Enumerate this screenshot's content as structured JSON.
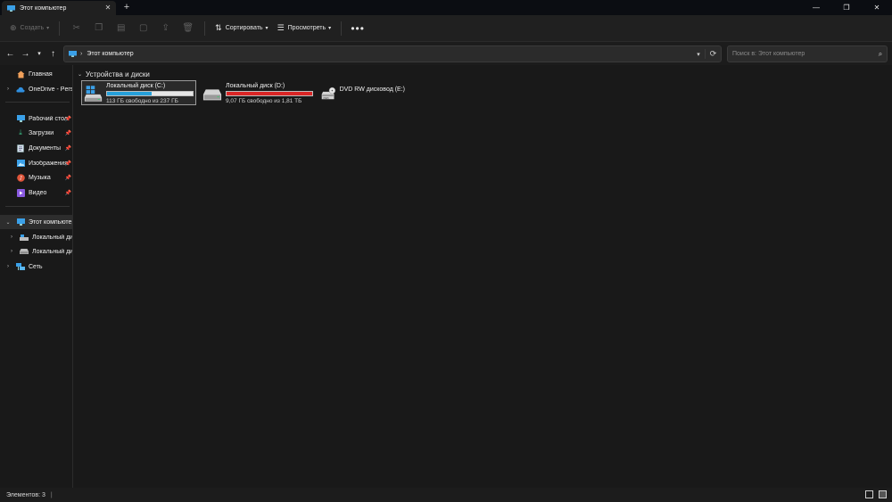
{
  "window": {
    "tab_title": "Этот компьютер",
    "tab_close": "✕",
    "new_tab": "+",
    "minimize": "—",
    "maximize": "❐",
    "close": "✕"
  },
  "toolbar": {
    "new_label": "Создать",
    "sort_label": "Сортировать",
    "view_label": "Просмотреть",
    "more": "•••"
  },
  "address": {
    "crumb": "Этот компьютер",
    "search_placeholder": "Поиск в: Этот компьютер"
  },
  "sidebar": {
    "items": [
      {
        "label": "Главная",
        "icon": "home-icon"
      },
      {
        "label": "OneDrive - Personal",
        "icon": "cloud-icon"
      },
      {
        "label": "Рабочий стол",
        "icon": "desktop-icon",
        "pinned": true
      },
      {
        "label": "Загрузки",
        "icon": "download-icon",
        "pinned": true
      },
      {
        "label": "Документы",
        "icon": "document-icon",
        "pinned": true
      },
      {
        "label": "Изображения",
        "icon": "image-icon",
        "pinned": true
      },
      {
        "label": "Музыка",
        "icon": "music-icon",
        "pinned": true
      },
      {
        "label": "Видео",
        "icon": "video-icon",
        "pinned": true
      },
      {
        "label": "Этот компьютер",
        "icon": "pc-icon",
        "selected": true
      },
      {
        "label": "Локальный диск (C:)",
        "icon": "drive-icon"
      },
      {
        "label": "Локальный диск (D:)",
        "icon": "drive-icon"
      },
      {
        "label": "Сеть",
        "icon": "network-icon"
      }
    ]
  },
  "content": {
    "group_title": "Устройства и диски",
    "drives": [
      {
        "name": "Локальный диск (C:)",
        "free": "113 ГБ свободно из 237 ГБ",
        "used_fraction": 0.52,
        "bar_color": "#26a0da",
        "icon": "windows-drive-icon"
      },
      {
        "name": "Локальный диск (D:)",
        "free": "9,07 ГБ свободно из 1,81 ТБ",
        "used_fraction": 0.995,
        "bar_color": "#da2626",
        "icon": "hard-drive-icon"
      },
      {
        "name": "DVD RW дисковод (E:)",
        "icon": "dvd-drive-icon",
        "dvd_label": "DVD"
      }
    ]
  },
  "status": {
    "items_count": "Элементов: 3",
    "separator": "|"
  }
}
